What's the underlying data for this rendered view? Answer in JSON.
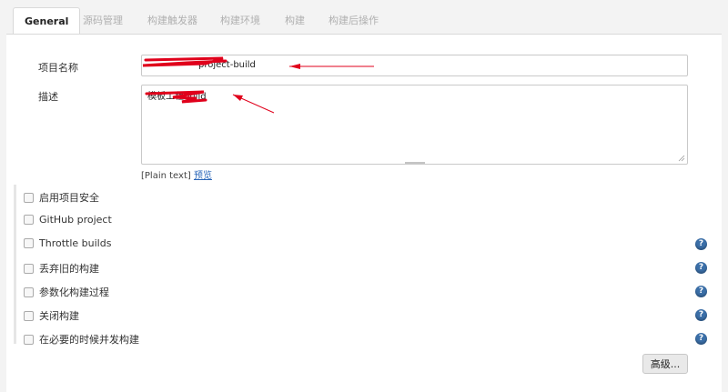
{
  "tabs": [
    {
      "label": "General",
      "active": true
    },
    {
      "label": "源码管理"
    },
    {
      "label": "构建触发器"
    },
    {
      "label": "构建环境"
    },
    {
      "label": "构建"
    },
    {
      "label": "构建后操作"
    }
  ],
  "form": {
    "project_name_label": "项目名称",
    "project_name_value": "project-build",
    "description_label": "描述",
    "description_value": "模板工程build",
    "plain_text": "[Plain text]",
    "preview_link": "预览"
  },
  "options": [
    {
      "label": "启用项目安全",
      "help": false
    },
    {
      "label": "GitHub project",
      "help": false
    },
    {
      "label": "Throttle builds",
      "help": true
    },
    {
      "label": "丢弃旧的构建",
      "help": true
    },
    {
      "label": "参数化构建过程",
      "help": true
    },
    {
      "label": "关闭构建",
      "help": true
    },
    {
      "label": "在必要的时候并发构建",
      "help": true
    }
  ],
  "help_icon_glyph": "?",
  "advanced_button": "高级...",
  "colors": {
    "accent": "#2a66b8",
    "redaction": "#e0001b",
    "help": "#3b6fa8"
  }
}
